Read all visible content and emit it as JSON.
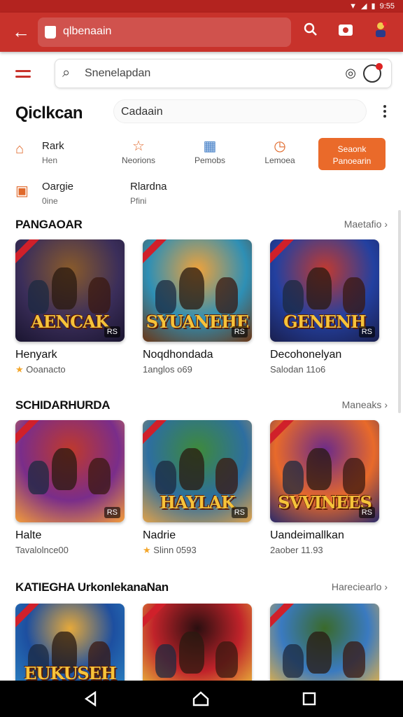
{
  "status": {
    "time": "9:55"
  },
  "appbar": {
    "url_text": "qlbenaain"
  },
  "search": {
    "placeholder": "Snenelapdan"
  },
  "header": {
    "title": "Qiclkcan",
    "filter_value": "Cadaain"
  },
  "categories": [
    {
      "label": "Rark",
      "sub": "Hen",
      "icon": "home-icon"
    },
    {
      "label": "Neorions",
      "icon": "star-icon"
    },
    {
      "label": "Pemobs",
      "icon": "grid-icon"
    },
    {
      "label": "Lemoea",
      "icon": "clock-icon"
    },
    {
      "label": "Oargie",
      "sub": "0ine",
      "icon": "box-icon"
    },
    {
      "label": "Rlardna",
      "sub": "Pfini"
    }
  ],
  "cta": {
    "line1": "Seaonk",
    "line2": "Panoearin"
  },
  "sections": [
    {
      "title": "PANGAOAR",
      "more": "Maetafio",
      "items": [
        {
          "art_title": "AENCAK",
          "badge": "RS",
          "name": "Henyark",
          "sub": "Ooanacto",
          "star": true,
          "colors": [
            "#3b2e5a",
            "#8a5b2a",
            "#1a1530"
          ]
        },
        {
          "art_title": "SYUANEHE",
          "badge": "RS",
          "name": "Noqdhondada",
          "sub": "1anglos o69",
          "star": false,
          "colors": [
            "#2e8fb5",
            "#f0a23a",
            "#6b3615"
          ]
        },
        {
          "art_title": "GENENH",
          "badge": "RS",
          "name": "Decohonelyan",
          "sub": "Salodan 11o6",
          "star": false,
          "colors": [
            "#2340a0",
            "#c23a2f",
            "#1a1f4e"
          ]
        }
      ]
    },
    {
      "title": "SCHIDARHURDA",
      "more": "Maneaks",
      "items": [
        {
          "art_title": "",
          "badge": "RS",
          "name": "Halte",
          "sub": "Tavalolnce00",
          "star": false,
          "colors": [
            "#7a2d8a",
            "#c0392b",
            "#f39c3a"
          ]
        },
        {
          "art_title": "HAYLAK",
          "badge": "RS",
          "name": "Nadrie",
          "sub": "Slinn 0593",
          "star": true,
          "colors": [
            "#2d6ea0",
            "#3e8a3a",
            "#e0a24a"
          ]
        },
        {
          "art_title": "SVVINEES",
          "badge": "RS",
          "name": "Uandeimallkan",
          "sub": "2aober 11.93",
          "star": false,
          "colors": [
            "#e86a2a",
            "#6a2a8a",
            "#2a2a6a"
          ]
        }
      ]
    },
    {
      "title": "KATIEGHA UrkonlekanaNan",
      "more": "Hareciearlo",
      "items": [
        {
          "art_title": "EUKUSEH",
          "badge": "",
          "name": "",
          "sub": "",
          "star": false,
          "colors": [
            "#1d4fa0",
            "#e6a93a",
            "#2a80c0"
          ]
        },
        {
          "art_title": "",
          "badge": "",
          "name": "",
          "sub": "",
          "star": false,
          "colors": [
            "#c0232a",
            "#2a0f10",
            "#e8b23a"
          ]
        },
        {
          "art_title": "",
          "badge": "",
          "name": "",
          "sub": "",
          "star": false,
          "colors": [
            "#3a7ac0",
            "#3a6a2a",
            "#e0b04a"
          ]
        }
      ]
    }
  ]
}
